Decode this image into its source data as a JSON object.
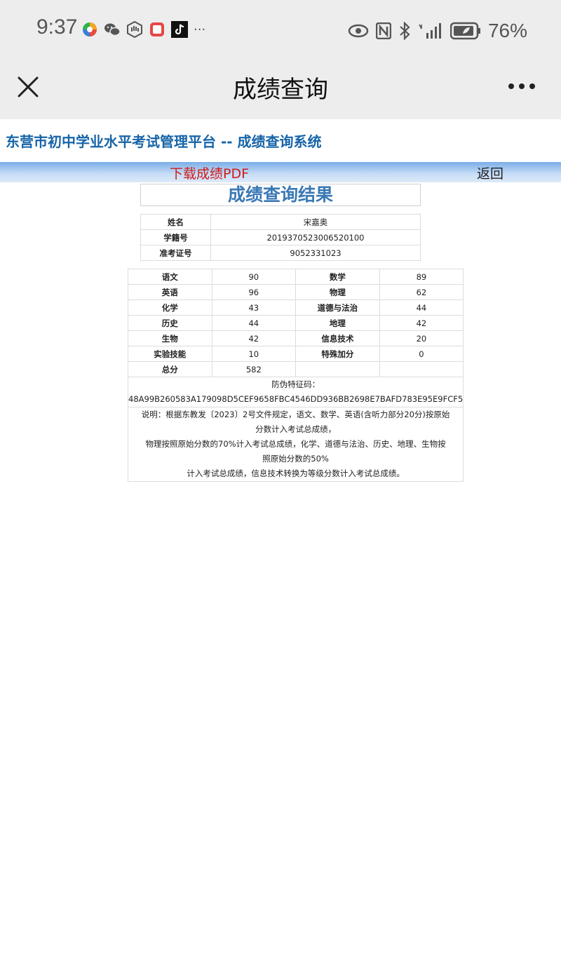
{
  "status_bar": {
    "time": "9:37",
    "more_indicator": "···",
    "battery": "76%"
  },
  "nav": {
    "title": "成绩查询"
  },
  "platform": {
    "title": "东营市初中学业水平考试管理平台 -- 成绩查询系统",
    "download_label": "下载成绩PDF",
    "back_label": "返回"
  },
  "result": {
    "title": "成绩查询结果",
    "info": [
      {
        "label": "姓名",
        "value": "宋嘉奥"
      },
      {
        "label": "学籍号",
        "value": "2019370523006520100"
      },
      {
        "label": "准考证号",
        "value": "9052331023"
      }
    ],
    "scores": [
      [
        {
          "label": "语文",
          "value": "90"
        },
        {
          "label": "数学",
          "value": "89"
        }
      ],
      [
        {
          "label": "英语",
          "value": "96"
        },
        {
          "label": "物理",
          "value": "62"
        }
      ],
      [
        {
          "label": "化学",
          "value": "43"
        },
        {
          "label": "道德与法治",
          "value": "44"
        }
      ],
      [
        {
          "label": "历史",
          "value": "44"
        },
        {
          "label": "地理",
          "value": "42"
        }
      ],
      [
        {
          "label": "生物",
          "value": "42"
        },
        {
          "label": "信息技术",
          "value": "20"
        }
      ],
      [
        {
          "label": "实验技能",
          "value": "10"
        },
        {
          "label": "特殊加分",
          "value": "0"
        }
      ],
      [
        {
          "label": "总分",
          "value": "582"
        },
        {
          "label": "",
          "value": ""
        }
      ]
    ],
    "anti_fake_label": "防伪特征码：",
    "anti_fake_code": "48A99B260583A179098D5CEF9658FBC4546DD936BB2698E7BAFD783E95E9FCF5",
    "note_lines": [
      "说明：根据东教发〔2023〕2号文件规定，语文、数学、英语(含听力部分20分)按原始",
      "分数计入考试总成绩，",
      "物理按照原始分数的70%计入考试总成绩，化学、道德与法治、历史、地理、生物按",
      "照原始分数的50%",
      "计入考试总成绩，信息技术转换为等级分数计入考试总成绩。"
    ]
  },
  "colors": {
    "platform_title": "#1664a8",
    "download_link": "#d11a1a",
    "result_title": "#3a78b5"
  }
}
